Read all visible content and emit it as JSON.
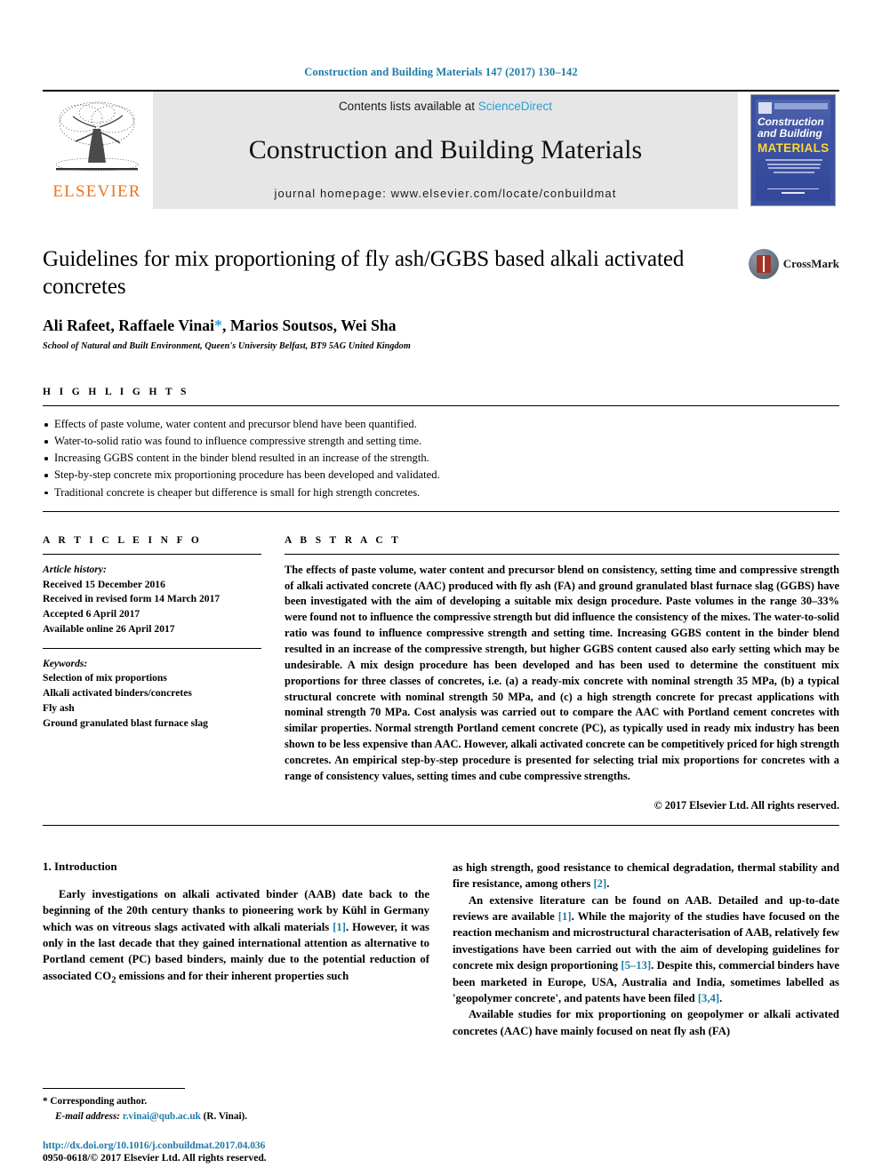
{
  "running_head": "Construction and Building Materials 147 (2017) 130–142",
  "masthead": {
    "publisher": "ELSEVIER",
    "contents_prefix": "Contents lists available at ",
    "contents_link": "ScienceDirect",
    "journal_title": "Construction and Building Materials",
    "homepage": "journal homepage: www.elsevier.com/locate/conbuildmat",
    "cover": {
      "line1": "Construction",
      "line2": "and Building",
      "line3": "MATERIALS"
    }
  },
  "article": {
    "title": "Guidelines for mix proportioning of fly ash/GGBS based alkali activated concretes",
    "authors": "Ali Rafeet, Raffaele Vinai",
    "authors_rest": ", Marios Soutsos, Wei Sha",
    "corresponding_marker": "*",
    "affiliation": "School of Natural and Built Environment, Queen's University Belfast, BT9 5AG United Kingdom",
    "crossmark_label": "CrossMark"
  },
  "highlights": {
    "heading": "H I G H L I G H T S",
    "items": [
      "Effects of paste volume, water content and precursor blend have been quantified.",
      "Water-to-solid ratio was found to influence compressive strength and setting time.",
      "Increasing GGBS content in the binder blend resulted in an increase of the strength.",
      "Step-by-step concrete mix proportioning procedure has been developed and validated.",
      "Traditional concrete is cheaper but difference is small for high strength concretes."
    ]
  },
  "article_info": {
    "heading": "A R T I C L E    I N F O",
    "history_label": "Article history:",
    "history": [
      "Received 15 December 2016",
      "Received in revised form 14 March 2017",
      "Accepted 6 April 2017",
      "Available online 26 April 2017"
    ],
    "keywords_label": "Keywords:",
    "keywords": [
      "Selection of mix proportions",
      "Alkali activated binders/concretes",
      "Fly ash",
      "Ground granulated blast furnace slag"
    ]
  },
  "abstract": {
    "heading": "A B S T R A C T",
    "text": "The effects of paste volume, water content and precursor blend on consistency, setting time and compressive strength of alkali activated concrete (AAC) produced with fly ash (FA) and ground granulated blast furnace slag (GGBS) have been investigated with the aim of developing a suitable mix design procedure. Paste volumes in the range 30–33% were found not to influence the compressive strength but did influence the consistency of the mixes. The water-to-solid ratio was found to influence compressive strength and setting time. Increasing GGBS content in the binder blend resulted in an increase of the compressive strength, but higher GGBS content caused also early setting which may be undesirable. A mix design procedure has been developed and has been used to determine the constituent mix proportions for three classes of concretes, i.e. (a) a ready-mix concrete with nominal strength 35 MPa, (b) a typical structural concrete with nominal strength 50 MPa, and (c) a high strength concrete for precast applications with nominal strength 70 MPa. Cost analysis was carried out to compare the AAC with Portland cement concretes with similar properties. Normal strength Portland cement concrete (PC), as typically used in ready mix industry has been shown to be less expensive than AAC. However, alkali activated concrete can be competitively priced for high strength concretes. An empirical step-by-step procedure is presented for selecting trial mix proportions for concretes with a range of consistency values, setting times and cube compressive strengths.",
    "copyright": "© 2017 Elsevier Ltd. All rights reserved."
  },
  "body": {
    "section_number_title": "1. Introduction",
    "left_paragraph_1_a": "Early investigations on alkali activated binder (AAB) date back to the beginning of the 20th century thanks to pioneering work by Kühl in Germany which was on vitreous slags activated with alkali materials ",
    "left_ref_1": "[1]",
    "left_paragraph_1_b": ". However, it was only in the last decade that they gained international attention as alternative to Portland cement (PC) based binders, mainly due to the potential reduction of associated CO",
    "left_paragraph_1_sub": "2",
    "left_paragraph_1_c": " emissions and for their inherent properties such",
    "right_paragraph_1_a": "as high strength, good resistance to chemical degradation, thermal stability and fire resistance, among others ",
    "right_ref_2": "[2]",
    "right_paragraph_1_b": ".",
    "right_paragraph_2_a": "An extensive literature can be found on AAB. Detailed and up-to-date reviews are available ",
    "right_ref_1": "[1]",
    "right_paragraph_2_b": ". While the majority of the studies have focused on the reaction mechanism and microstructural characterisation of AAB, relatively few investigations have been carried out with the aim of developing guidelines for concrete mix design proportioning ",
    "right_ref_5_13": "[5–13]",
    "right_paragraph_2_c": ". Despite this, commercial binders have been marketed in Europe, USA, Australia and India, sometimes labelled as 'geopolymer concrete', and patents have been filed ",
    "right_ref_3_4": "[3,4]",
    "right_paragraph_2_d": ".",
    "right_paragraph_3": "Available studies for mix proportioning on geopolymer or alkali activated concretes (AAC) have mainly focused on neat fly ash (FA)"
  },
  "footnote": {
    "corresponding_marker": "*",
    "corresponding_text": "Corresponding author.",
    "email_label": "E-mail address:",
    "email": "r.vinai@qub.ac.uk",
    "email_owner": "(R. Vinai)."
  },
  "footer": {
    "doi": "http://dx.doi.org/10.1016/j.conbuildmat.2017.04.036",
    "issn": "0950-0618/© 2017 Elsevier Ltd. All rights reserved."
  },
  "colors": {
    "link": "#1f7ba6",
    "sciencedirect": "#2a9fd6",
    "elsevier_orange": "#E87722",
    "banner_gray": "#e6e6e6"
  }
}
